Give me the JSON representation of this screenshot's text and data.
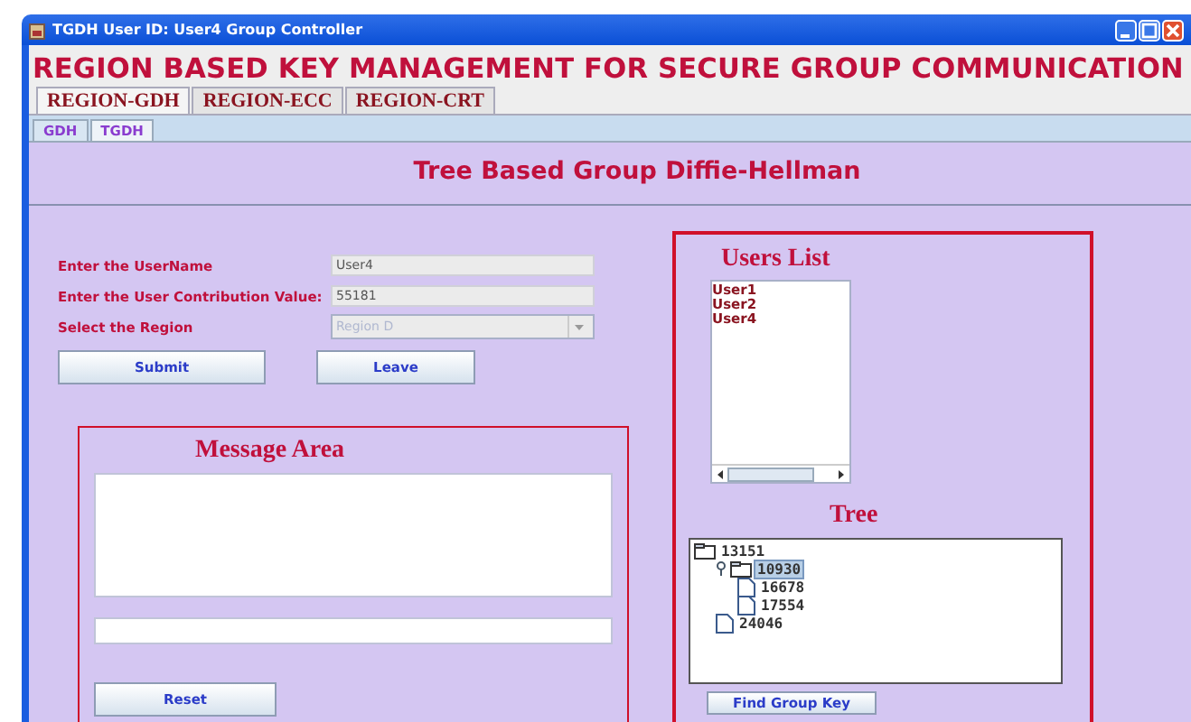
{
  "window": {
    "title": "TGDH User ID: User4 Group Controller"
  },
  "heading": "REGION BASED KEY MANAGEMENT FOR SECURE GROUP COMMUNICATION",
  "tabs": [
    {
      "label": "REGION-GDH",
      "selected": true
    },
    {
      "label": "REGION-ECC",
      "selected": false
    },
    {
      "label": "REGION-CRT",
      "selected": false
    }
  ],
  "subtabs": [
    {
      "label": "GDH",
      "selected": false
    },
    {
      "label": "TGDH",
      "selected": true
    }
  ],
  "panel_title": "Tree Based Group Diffie-Hellman",
  "form": {
    "fields": [
      {
        "kind": "text",
        "label": "Enter the UserName",
        "value": "User4",
        "disabled": false
      },
      {
        "kind": "text",
        "label": "Enter the User Contribution Value:",
        "value": "55181",
        "disabled": false
      },
      {
        "kind": "dropdown",
        "label": "Select the Region",
        "value": "Region D",
        "disabled": true
      }
    ],
    "buttons": [
      "Submit",
      "Leave"
    ]
  },
  "message_area": {
    "title": "Message Area",
    "button": "Reset"
  },
  "users_list": {
    "title": "Users List",
    "items": [
      "User1",
      "User2",
      "User4"
    ]
  },
  "tree": {
    "title": "Tree",
    "nodes": [
      {
        "label": "13151",
        "kind": "folder",
        "expanded": true,
        "selected": false,
        "children": [
          {
            "label": "10930",
            "kind": "folder",
            "expanded": true,
            "selected": true,
            "children": [
              {
                "label": "16678",
                "kind": "leaf",
                "selected": false
              },
              {
                "label": "17554",
                "kind": "leaf",
                "selected": false
              }
            ]
          },
          {
            "label": "24046",
            "kind": "leaf",
            "selected": false
          }
        ]
      }
    ],
    "button": "Find Group Key"
  }
}
